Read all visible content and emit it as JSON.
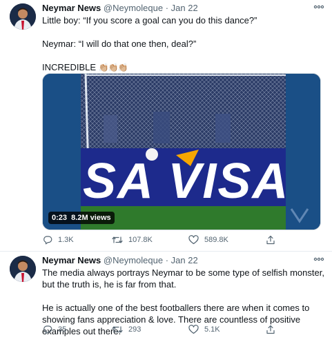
{
  "tweets": [
    {
      "name": "Neymar News",
      "handle": "@Neymoleque",
      "date": "Jan 22",
      "lines": [
        "Little boy: “If you score a goal can you do this dance?”",
        "Neymar: “I will do that one then, deal?”",
        "INCREDIBLE"
      ],
      "emoji": "👏🏼👏🏼👏🏼",
      "video": {
        "time": "0:23",
        "views": "8.2M views",
        "board_text": "SA VISA",
        "brand_colors": {
          "board": "#1d2a8c",
          "pitch": "#2f7a2c",
          "accent": "#f7a600"
        }
      },
      "stats": {
        "replies": "1.3K",
        "retweets": "107.8K",
        "likes": "589.8K"
      }
    },
    {
      "name": "Neymar News",
      "handle": "@Neymoleque",
      "date": "Jan 22",
      "paragraphs": [
        "The media always portrays Neymar to be some type of selfish monster, but the truth is, he is far from that.",
        "He is actually one of the best footballers there are when it comes to showing fans appreciation & love. There are countless of positive examples out there."
      ],
      "stats": {
        "replies": "35",
        "retweets": "293",
        "likes": "5.1K"
      }
    }
  ],
  "icons": [
    "avatar",
    "more-icon",
    "reply-icon",
    "retweet-icon",
    "like-icon",
    "share-icon"
  ]
}
